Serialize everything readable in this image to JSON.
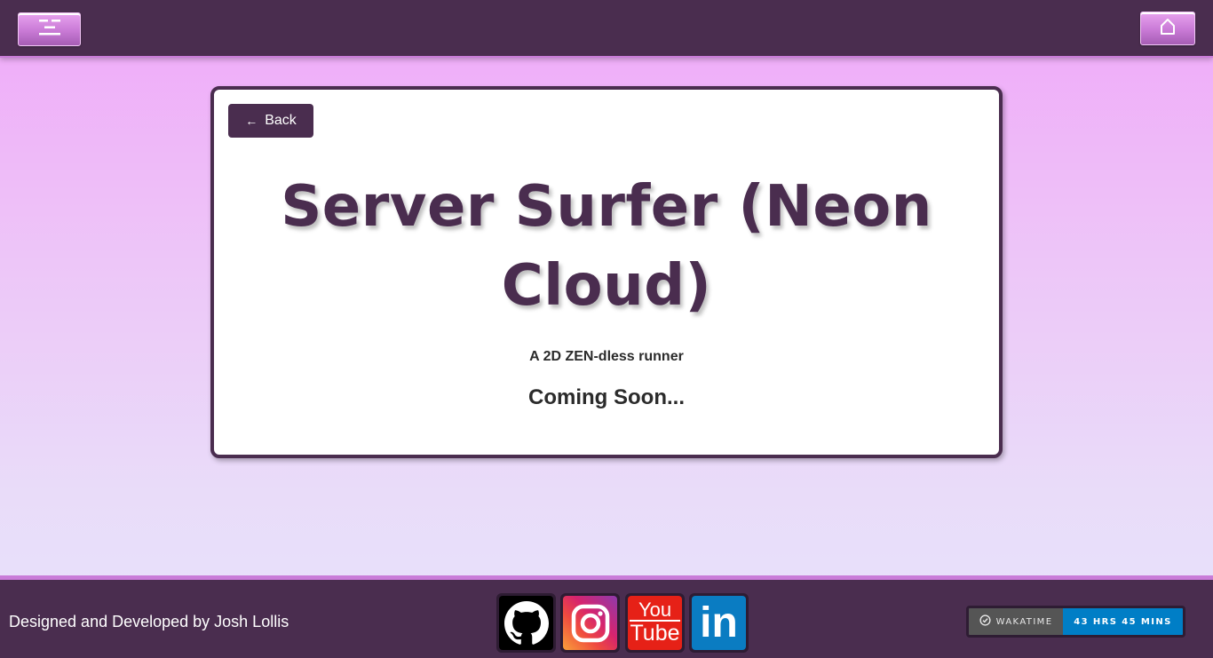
{
  "header": {
    "menu_icon": "hamburger-icon",
    "home_icon": "home-icon"
  },
  "card": {
    "back_label": "Back",
    "back_icon": "left-arrow-icon",
    "title": "Server Surfer (Neon Cloud)",
    "subtitle": "A 2D ZEN-dless runner",
    "status": "Coming Soon..."
  },
  "footer": {
    "credit": "Designed and Developed by Josh Lollis",
    "social": [
      {
        "name": "GitHub",
        "icon": "github-icon"
      },
      {
        "name": "Instagram",
        "icon": "instagram-icon"
      },
      {
        "name": "YouTube",
        "icon": "youtube-icon",
        "text_top": "You",
        "text_bottom": "Tube"
      },
      {
        "name": "LinkedIn",
        "icon": "linkedin-icon",
        "text": "in"
      }
    ],
    "wakatime": {
      "label": "WAKATIME",
      "value": "43 HRS 45 MINS"
    }
  },
  "colors": {
    "primary": "#4a2d4f",
    "accent": "#c97cd8",
    "wakatime_blue": "#007ec6"
  }
}
